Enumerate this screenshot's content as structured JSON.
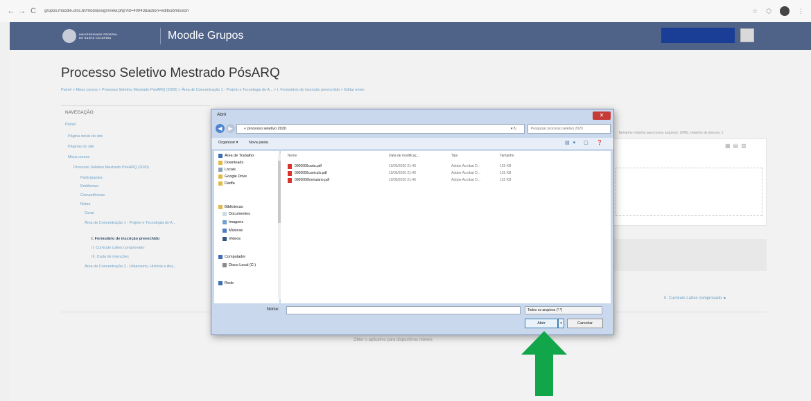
{
  "browser": {
    "back": "←",
    "forward": "→",
    "reload": "C",
    "url": "grupos.moodle.ufsc.br/mod/assign/view.php?id=40043&action=editsubmission"
  },
  "header": {
    "university": [
      "UNIVERSIDADE FEDERAL",
      "DE SANTA CATARINA"
    ],
    "site_name": "Moodle Grupos"
  },
  "page": {
    "title": "Processo Seletivo Mestrado PósARQ",
    "breadcrumb": "Painel > Meus cursos > Processo Seletivo Mestrado PósARQ (2020) > Área de Concentração 1 - Projeto e Tecnologia do A... > I. Formulário de inscrição preenchido > Editar envio"
  },
  "navigation": {
    "heading": "NAVEGAÇÃO",
    "items": [
      {
        "label": "Painel"
      },
      {
        "label": "Página inicial do site"
      },
      {
        "label": "Páginas do site"
      },
      {
        "label": "Meus cursos"
      },
      {
        "label": "Processo Seletivo Mestrado PósARQ (2020)"
      },
      {
        "label": "Participantes"
      },
      {
        "label": "Emblemas"
      },
      {
        "label": "Competências"
      },
      {
        "label": "Notas"
      },
      {
        "label": "Geral"
      },
      {
        "label": "Área de Concentração 1 - Projeto e Tecnologia do A..."
      },
      {
        "label": "I. Formulário de inscrição preenchido"
      },
      {
        "label": "II. Curriculo Lattes comprovado"
      },
      {
        "label": "III. Carta de intenções"
      },
      {
        "label": "Área de Concentração 2 - Urbanismo, História e Arq..."
      }
    ]
  },
  "content": {
    "max_size": "Tamanho máximo para novos arquivos: 20Mb, máximo de anexos: 1",
    "next_link": "II. Curriculo Lattes comprovado ►",
    "footer_text": "Obter o aplicativo para dispositivos móveis"
  },
  "dialog": {
    "title": "Abrir",
    "path": "« processo seletivo 2020",
    "search_placeholder": "Pesquisar processo seletivo 2020",
    "toolbar": {
      "organize": "Organizar ▾",
      "new_folder": "Nova pasta"
    },
    "nav_items": [
      {
        "label": "Área de Trabalho",
        "icon": "desktop-icon"
      },
      {
        "label": "Downloads",
        "icon": "downloads-icon"
      },
      {
        "label": "Locais",
        "icon": "places-icon"
      },
      {
        "label": "Google Drive",
        "icon": "drive-icon"
      },
      {
        "label": "Dadfa",
        "icon": "folder-icon"
      },
      {
        "label": "Bibliotecas",
        "icon": "library-icon"
      },
      {
        "label": "Documentos",
        "icon": "documents-icon"
      },
      {
        "label": "Imagens",
        "icon": "images-icon"
      },
      {
        "label": "Músicas",
        "icon": "music-icon"
      },
      {
        "label": "Vídeos",
        "icon": "videos-icon"
      },
      {
        "label": "Computador",
        "icon": "computer-icon"
      },
      {
        "label": "Disco Local (C:)",
        "icon": "disk-icon"
      },
      {
        "label": "Rede",
        "icon": "network-icon"
      }
    ],
    "columns": [
      "Nome",
      "Data de modificaç...",
      "Tipo",
      "Tamanho"
    ],
    "files": [
      {
        "name": "0000000carta.pdf",
        "date": "19/06/2020 21:40",
        "type": "Adobe Acrobat D...",
        "size": "125 KB"
      },
      {
        "name": "0000000curriculo.pdf",
        "date": "19/06/2020 21:40",
        "type": "Adobe Acrobat D...",
        "size": "125 KB"
      },
      {
        "name": "0000000formulario.pdf",
        "date": "19/06/2020 21:40",
        "type": "Adobe Acrobat D...",
        "size": "125 KB"
      }
    ],
    "name_label": "Nome:",
    "file_type": "Todos os arquivos (*.*)",
    "open_label": "Abrir",
    "cancel_label": "Cancelar"
  },
  "colors": {
    "header": "#4f6288",
    "arrow": "#11a64a"
  }
}
